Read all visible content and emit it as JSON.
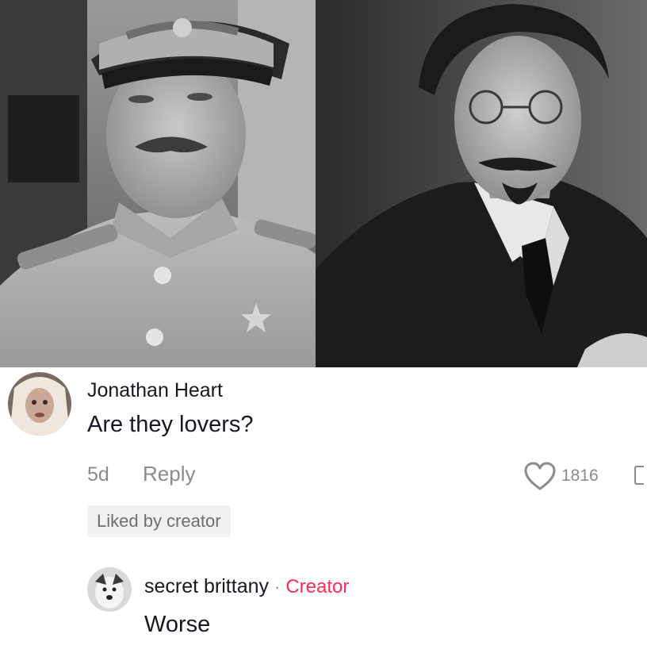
{
  "photos": {
    "left": {
      "name": "portrait-uniform"
    },
    "right": {
      "name": "portrait-suit"
    }
  },
  "comment": {
    "username": "Jonathan Heart",
    "text": "Are they lovers?",
    "time": "5d",
    "reply_label": "Reply",
    "like_icon": "heart-outline-icon",
    "like_count": "1816",
    "liked_badge": "Liked by creator"
  },
  "reply": {
    "username": "secret brittany",
    "separator": "·",
    "badge": "Creator",
    "text": "Worse"
  },
  "colors": {
    "text_primary": "#161823",
    "text_secondary": "#8a8b91",
    "creator_accent": "#fe2c55",
    "badge_bg": "#f1f1f2"
  }
}
